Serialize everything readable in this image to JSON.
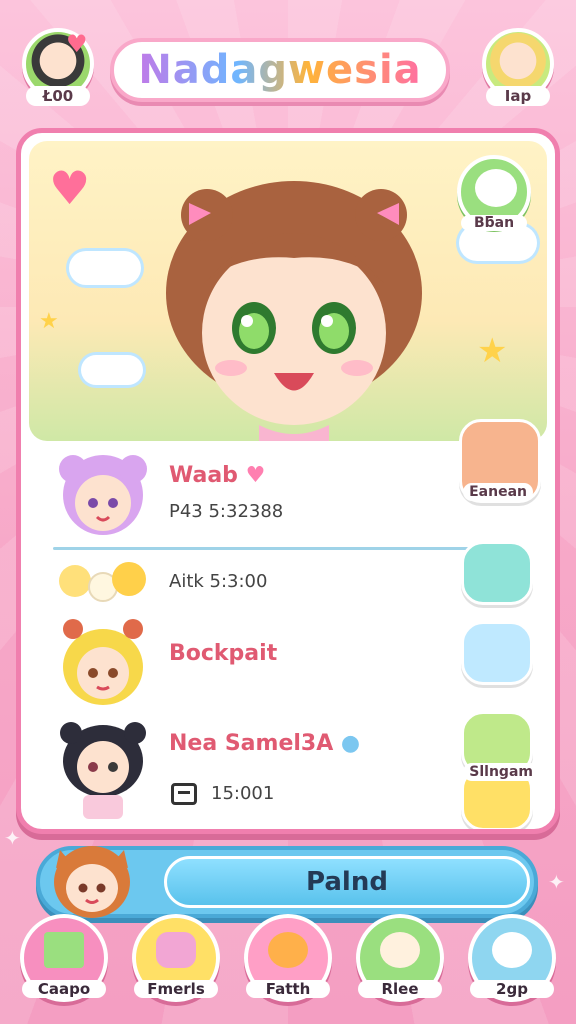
{
  "header": {
    "title": "Nadagwesia",
    "left_label": "Ł00",
    "right_label": "Iap"
  },
  "hero": {
    "badge_label": "Bƃan",
    "side_button_label": "Eanean"
  },
  "rows": [
    {
      "name": "Waab ",
      "detail": "P43 5:32388",
      "button_color": "#f7b48e"
    },
    {
      "name": "",
      "detail": "Aitk 5:3:00",
      "button_color": "#8fe3d8"
    },
    {
      "name": "Bockpait",
      "detail": "",
      "button_color": "#bfe9ff"
    },
    {
      "name": "Nea Samel3A",
      "detail": "15:001",
      "button_color": "#bfe98a",
      "button_label": "Sllngam"
    }
  ],
  "play": {
    "label": "Palnd"
  },
  "nav": [
    {
      "label": "Caapo",
      "icon": "home-icon",
      "color": "#f78fbf"
    },
    {
      "label": "Fmerls",
      "icon": "notebook-icon",
      "color": "#ffe066"
    },
    {
      "label": "Fatth",
      "icon": "cat-icon",
      "color": "#ff9fc6"
    },
    {
      "label": "Rlee",
      "icon": "character-icon",
      "color": "#9adf7f"
    },
    {
      "label": "2gp",
      "icon": "pet-icon",
      "color": "#8fd6f0"
    }
  ],
  "colors": {
    "accent_pink": "#f07fae",
    "accent_blue": "#6cc8ef",
    "name_red": "#e05a72"
  }
}
